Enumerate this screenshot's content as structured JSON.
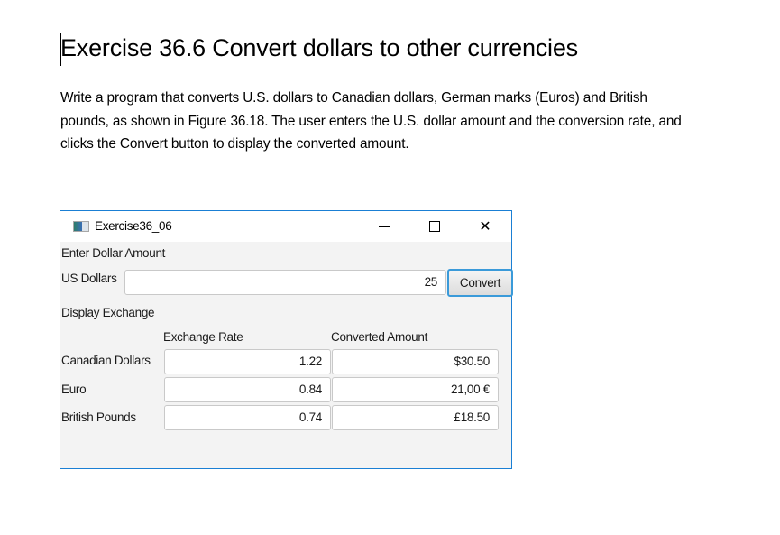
{
  "document": {
    "heading": "Exercise 36.6  Convert dollars to other currencies",
    "paragraph_lines": [
      "Write a program that converts U.S. dollars to Canadian dollars, German marks (Euros) and British",
      "pounds, as shown in Figure 36.18.  The user enters the U.S. dollar amount and the conversion rate, and",
      "clicks the Convert button to display the converted amount."
    ]
  },
  "window": {
    "title": "Exercise36_06",
    "icon": "app-window-icon",
    "controls": {
      "minimize": "minimize-icon",
      "maximize": "maximize-icon",
      "close": "close-icon",
      "close_glyph": "✕"
    },
    "border_color": "#1a7fd4"
  },
  "form": {
    "enter_section_label": "Enter Dollar Amount",
    "us_dollars_label": "US Dollars",
    "us_dollars_value": "25",
    "convert_label": "Convert",
    "display_section_label": "Display Exchange",
    "col_rate_header": "Exchange Rate",
    "col_amount_header": "Converted Amount",
    "rows": [
      {
        "currency": "Canadian Dollars",
        "rate": "1.22",
        "amount": "$30.50"
      },
      {
        "currency": "Euro",
        "rate": "0.84",
        "amount": "21,00 €"
      },
      {
        "currency": "British Pounds",
        "rate": "0.74",
        "amount": "£18.50"
      }
    ]
  }
}
